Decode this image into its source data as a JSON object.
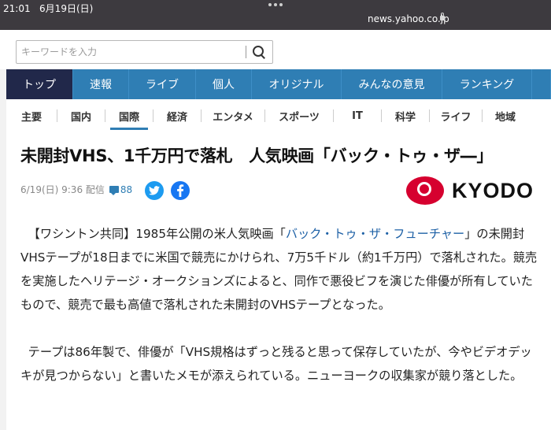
{
  "status_bar": {
    "time": "21:01",
    "date": "6月19日(日)",
    "url": "news.yahoo.co.jp"
  },
  "search": {
    "placeholder": "キーワードを入力"
  },
  "main_nav": [
    "トップ",
    "速報",
    "ライブ",
    "個人",
    "オリジナル",
    "みんなの意見",
    "ランキング"
  ],
  "sub_nav": [
    "主要",
    "国内",
    "国際",
    "経済",
    "エンタメ",
    "スポーツ",
    "IT",
    "科学",
    "ライフ",
    "地域"
  ],
  "article": {
    "headline": "未開封VHS、1千万円で落札　人気映画「バック・トゥ・ザ―」",
    "date": "6/19(日) 9:36 配信",
    "comment_count": "88",
    "source": "KYODO",
    "paragraph1_a": "【ワシントン共同】1985年公開の米人気映画「",
    "paragraph1_link": "バック・トゥ・ザ・フューチャー",
    "paragraph1_b": "」の未開封VHSテープが18日までに米国で競売にかけられ、7万5千ドル（約1千万円）で落札された。競売を実施したヘリテージ・オークションズによると、同作で悪役ビフを演じた俳優が所有していたもので、競売で最も高値で落札された未開封のVHSテープとなった。",
    "paragraph2": "テープは86年製で、俳優が「VHS規格はずっと残ると思って保存していたが、今やビデオデッキが見つからない」と書いたメモが添えられている。ニューヨークの収集家が競り落とした。"
  },
  "colors": {
    "nav_blue": "#2f7eb4",
    "nav_active": "#21284a",
    "kyodo_red": "#d6002f"
  }
}
